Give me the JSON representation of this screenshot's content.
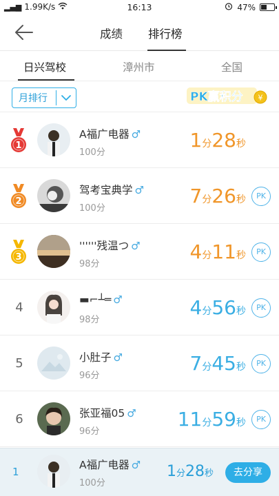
{
  "status_bar": {
    "carrier": "all",
    "speed": "1.99K/s",
    "time": "16:13",
    "battery": "47%",
    "battery_level": 0.47
  },
  "nav": {
    "back_icon": "back-arrow-icon",
    "tabs": [
      "成绩",
      "排行榜"
    ],
    "active_tab": 1
  },
  "regions": {
    "items": [
      "日兴驾校",
      "漳州市",
      "全国"
    ],
    "active": 0
  },
  "filter": {
    "label": "月排行",
    "icon": "chevron-down-icon"
  },
  "pk_banner": {
    "text": "PK赢积分"
  },
  "colors": {
    "accent": "#2eaee6",
    "gold_time": "#f0962a",
    "blue_time": "#3aaee3",
    "medal_red": "#e53935",
    "medal_orange": "#f08a24",
    "medal_gold": "#f5b700"
  },
  "rows": [
    {
      "rank": "1",
      "medal": "medal-1-icon",
      "medal_color": "#e53935",
      "name": "A福广电器",
      "gender": "♂",
      "score": "100分",
      "time": {
        "min": "1",
        "min_unit": "分",
        "sec": "28",
        "sec_unit": "秒"
      },
      "time_color": "#f0962a",
      "pk": ""
    },
    {
      "rank": "2",
      "medal": "medal-2-icon",
      "medal_color": "#f08a24",
      "name": "驾考宝典学",
      "gender": "♂",
      "score": "100分",
      "time": {
        "min": "7",
        "min_unit": "分",
        "sec": "26",
        "sec_unit": "秒"
      },
      "time_color": "#f0962a",
      "pk": "PK"
    },
    {
      "rank": "3",
      "medal": "medal-3-icon",
      "medal_color": "#f5b700",
      "name": "''''''残温つ",
      "gender": "♂",
      "score": "98分",
      "time": {
        "min": "4",
        "min_unit": "分",
        "sec": "11",
        "sec_unit": "秒"
      },
      "time_color": "#f0962a",
      "pk": "PK"
    },
    {
      "rank": "4",
      "medal": "",
      "medal_color": "",
      "name": "▬⌐┴═",
      "gender": "♂",
      "score": "98分",
      "time": {
        "min": "4",
        "min_unit": "分",
        "sec": "56",
        "sec_unit": "秒"
      },
      "time_color": "#3aaee3",
      "pk": "PK"
    },
    {
      "rank": "5",
      "medal": "",
      "medal_color": "",
      "name": "小肚子",
      "gender": "♂",
      "score": "96分",
      "time": {
        "min": "7",
        "min_unit": "分",
        "sec": "45",
        "sec_unit": "秒"
      },
      "time_color": "#3aaee3",
      "pk": "PK"
    },
    {
      "rank": "6",
      "medal": "",
      "medal_color": "",
      "name": "张亚福05",
      "gender": "♂",
      "score": "96分",
      "time": {
        "min": "11",
        "min_unit": "分",
        "sec": "59",
        "sec_unit": "秒"
      },
      "time_color": "#3aaee3",
      "pk": "PK"
    }
  ],
  "my_rank": {
    "rank": "1",
    "name": "A福广电器",
    "gender": "♂",
    "score": "100分",
    "time": {
      "min": "1",
      "min_unit": "分",
      "sec": "28",
      "sec_unit": "秒"
    },
    "share_label": "去分享"
  }
}
